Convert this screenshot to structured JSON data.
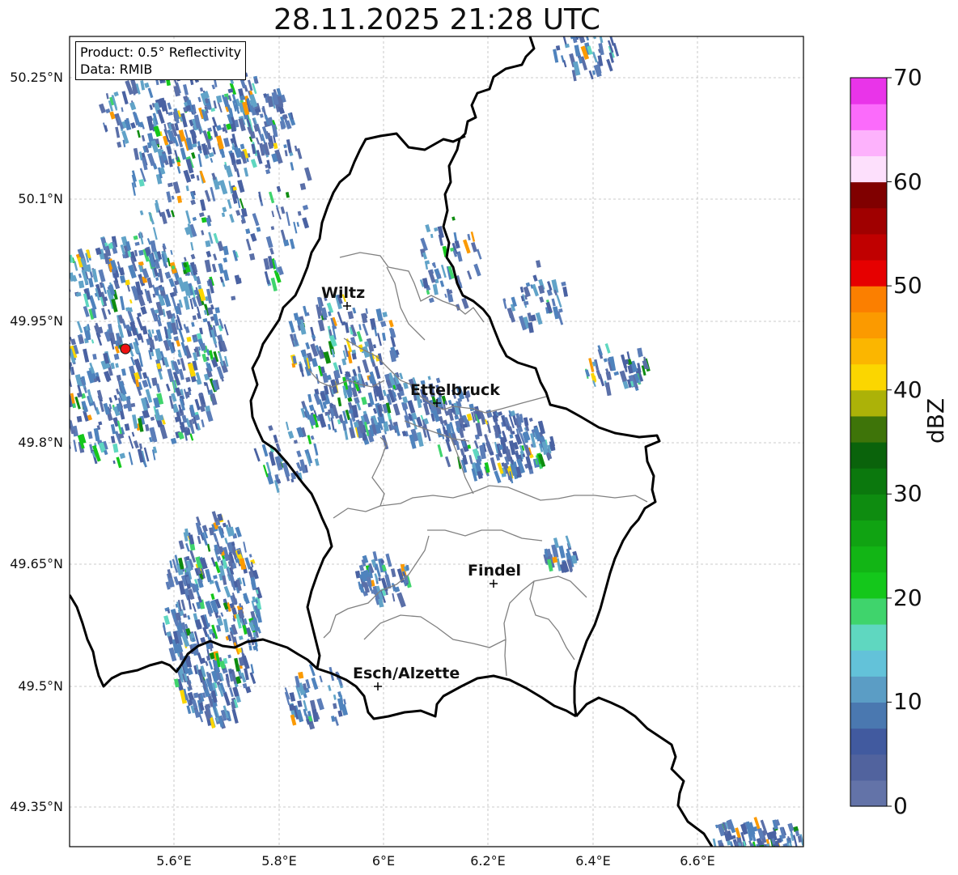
{
  "title": "28.11.2025 21:28 UTC",
  "info": {
    "product": "Product: 0.5° Reflectivity",
    "data_source": "Data: RMIB"
  },
  "lat_ticks": [
    "50.25°N",
    "50.1°N",
    "49.95°N",
    "49.8°N",
    "49.65°N",
    "49.5°N",
    "49.35°N"
  ],
  "lon_ticks": [
    "5.6°E",
    "5.8°E",
    "6°E",
    "6.2°E",
    "6.4°E",
    "6.6°E"
  ],
  "cities": [
    {
      "name": "Wiltz"
    },
    {
      "name": "Ettelbruck"
    },
    {
      "name": "Findel"
    },
    {
      "name": "Esch/Alzette"
    }
  ],
  "colorbar": {
    "label": "dBZ",
    "ticks": [
      "70",
      "60",
      "50",
      "40",
      "30",
      "20",
      "10",
      "0"
    ],
    "colors": [
      "#6373a8",
      "#51639e",
      "#415a9f",
      "#4a78b0",
      "#5b9dc5",
      "#63c2d9",
      "#5fd7c0",
      "#3fd46c",
      "#14c71b",
      "#12b515",
      "#10a312",
      "#0e8c10",
      "#0b780d",
      "#0a630b",
      "#3e7409",
      "#acb208",
      "#fbd600",
      "#fbb600",
      "#fb9a00",
      "#fb7f00",
      "#e60000",
      "#c00000",
      "#a00000",
      "#800000",
      "#fde0fc",
      "#fdb2fc",
      "#fb6bfb",
      "#e934e9"
    ]
  },
  "map": {
    "background": "#ffffff",
    "border_color": "#000000",
    "canton_color": "#808080",
    "grid_color": "#bbbbbb",
    "radar_site_color": "#ee1111"
  }
}
